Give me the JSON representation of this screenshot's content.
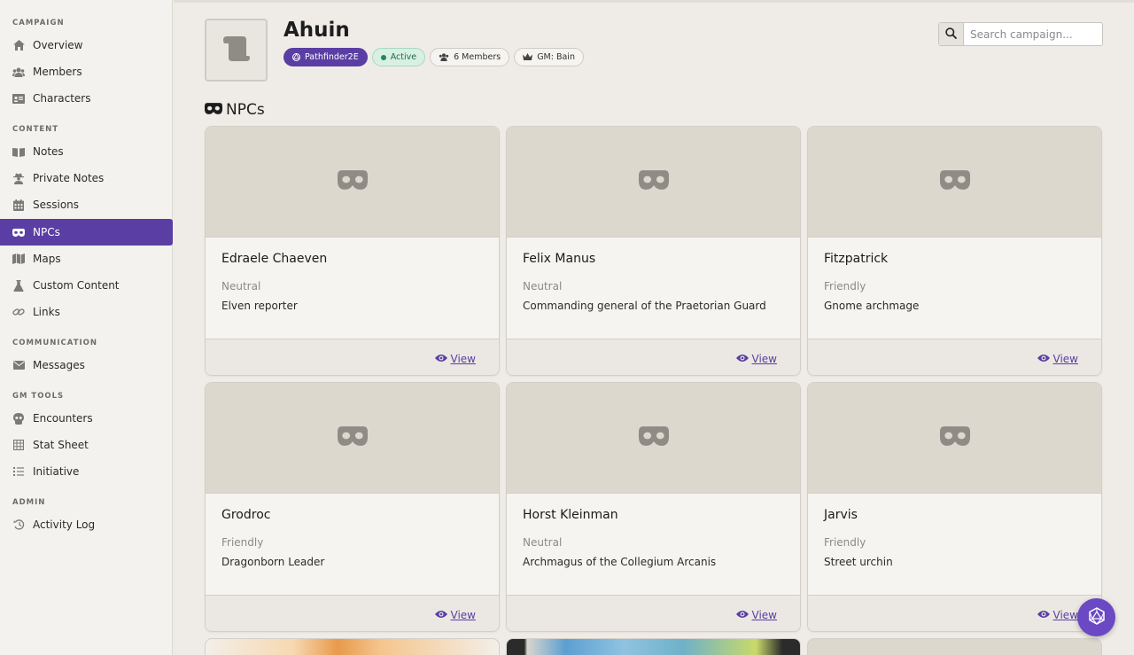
{
  "sidebar": {
    "sections": [
      {
        "label": "CAMPAIGN"
      },
      {
        "label": "CONTENT"
      },
      {
        "label": "COMMUNICATION"
      },
      {
        "label": "GM TOOLS"
      },
      {
        "label": "ADMIN"
      }
    ],
    "items": [
      {
        "label": "Overview",
        "icon": "home-icon"
      },
      {
        "label": "Members",
        "icon": "users-icon"
      },
      {
        "label": "Characters",
        "icon": "id-card-icon"
      },
      {
        "label": "Notes",
        "icon": "book-icon"
      },
      {
        "label": "Private Notes",
        "icon": "user-secret-icon"
      },
      {
        "label": "Sessions",
        "icon": "calendar-icon"
      },
      {
        "label": "NPCs",
        "icon": "mask-icon"
      },
      {
        "label": "Maps",
        "icon": "map-icon"
      },
      {
        "label": "Custom Content",
        "icon": "flask-icon"
      },
      {
        "label": "Links",
        "icon": "link-icon"
      },
      {
        "label": "Messages",
        "icon": "envelope-icon"
      },
      {
        "label": "Encounters",
        "icon": "skull-icon"
      },
      {
        "label": "Stat Sheet",
        "icon": "table-icon"
      },
      {
        "label": "Initiative",
        "icon": "list-ordered-icon"
      },
      {
        "label": "Activity Log",
        "icon": "history-icon"
      }
    ]
  },
  "header": {
    "title": "Ahuin",
    "badges": {
      "system": "Pathfinder2E",
      "status": "Active",
      "members": "6 Members",
      "gm": "GM: Bain"
    }
  },
  "search": {
    "placeholder": "Search campaign..."
  },
  "section": {
    "title": "NPCs"
  },
  "npcs": [
    {
      "name": "Edraele Chaeven",
      "disposition": "Neutral",
      "description": "Elven reporter",
      "view": "View"
    },
    {
      "name": "Felix Manus",
      "disposition": "Neutral",
      "description": "Commanding general of the Praetorian Guard",
      "view": "View"
    },
    {
      "name": "Fitzpatrick",
      "disposition": "Friendly",
      "description": "Gnome archmage",
      "view": "View"
    },
    {
      "name": "Grodroc",
      "disposition": "Friendly",
      "description": "Dragonborn Leader",
      "view": "View"
    },
    {
      "name": "Horst Kleinman",
      "disposition": "Neutral",
      "description": "Archmagus of the Collegium Arcanis",
      "view": "View"
    },
    {
      "name": "Jarvis",
      "disposition": "Friendly",
      "description": "Street urchin",
      "view": "View"
    }
  ],
  "colors": {
    "accent": "#5b3ea3",
    "fab": "#6b48c4"
  }
}
